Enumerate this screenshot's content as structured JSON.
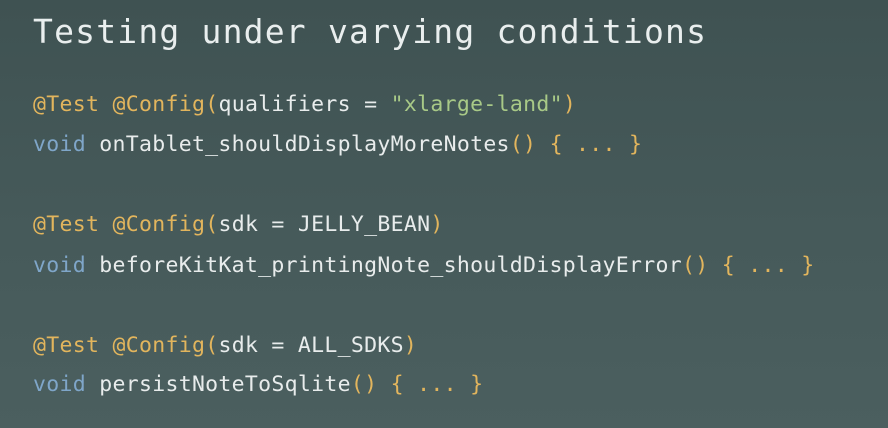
{
  "title": "Testing under varying conditions",
  "examples": [
    {
      "annotation_test": "@Test",
      "annotation_config": "@Config",
      "open_paren": "(",
      "config_args": "qualifiers = ",
      "config_string": "\"xlarge-land\"",
      "close_paren": ")",
      "return_type": "void",
      "method_name": "onTablet_shouldDisplayMoreNotes",
      "method_parens": "()",
      "body": "{ ... }"
    },
    {
      "annotation_test": "@Test",
      "annotation_config": "@Config",
      "open_paren": "(",
      "config_args": "sdk = JELLY_BEAN",
      "config_string": "",
      "close_paren": ")",
      "return_type": "void",
      "method_name": "beforeKitKat_printingNote_shouldDisplayError",
      "method_parens": "()",
      "body": "{ ... }"
    },
    {
      "annotation_test": "@Test",
      "annotation_config": "@Config",
      "open_paren": "(",
      "config_args": "sdk = ALL_SDKS",
      "config_string": "",
      "close_paren": ")",
      "return_type": "void",
      "method_name": "persistNoteToSqlite",
      "method_parens": "()",
      "body": "{ ... }"
    }
  ],
  "colors": {
    "background_top": "#3f5252",
    "background_bottom": "#4b5f5f",
    "title": "#e9eeee",
    "annotation": "#e2b55d",
    "keyword": "#7fa6c9",
    "string": "#a8c987",
    "identifier": "#e8ecec"
  }
}
